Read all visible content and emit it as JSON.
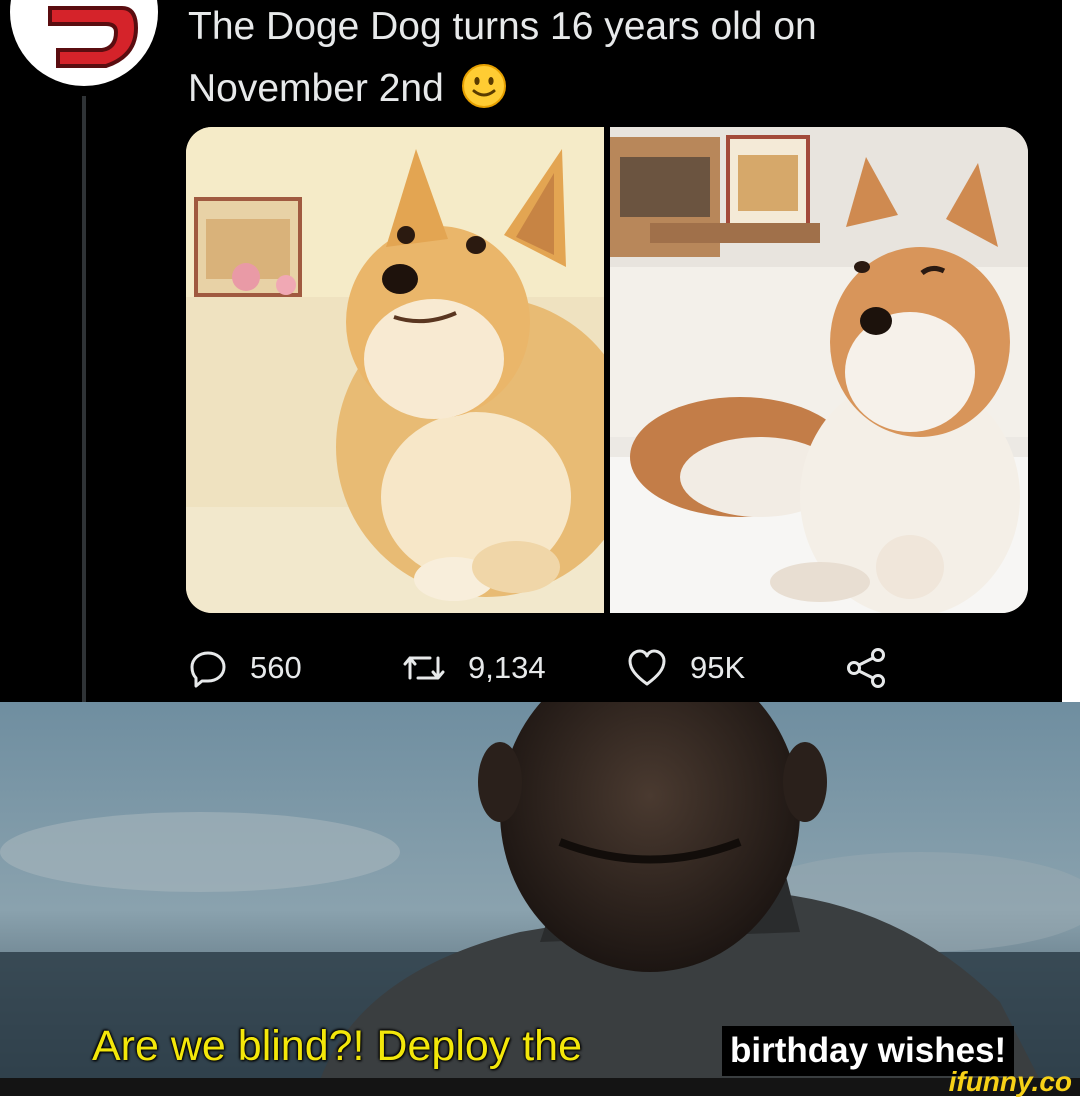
{
  "tweet": {
    "text_line1": "The Doge Dog turns 16 years old on",
    "text_line2": "November 2nd",
    "emoji": "slightly-smiling-face-icon",
    "photos": [
      {
        "name": "doge-photo",
        "description_visible": false
      },
      {
        "name": "cheems-photo",
        "description_visible": false
      }
    ],
    "actions": {
      "reply_count": "560",
      "retweet_count": "9,134",
      "like_count": "95K",
      "share_icon": "share-icon"
    }
  },
  "meme": {
    "caption_yellow": "Are we blind?! Deploy the",
    "caption_boxed": "birthday wishes!",
    "watermark": "ifunny.co"
  },
  "colors": {
    "tweet_bg": "#000000",
    "tweet_text": "#e7e9ea",
    "caption_yellow": "#f3e70a",
    "watermark": "#f7d117",
    "avatar_red": "#d5232a"
  }
}
